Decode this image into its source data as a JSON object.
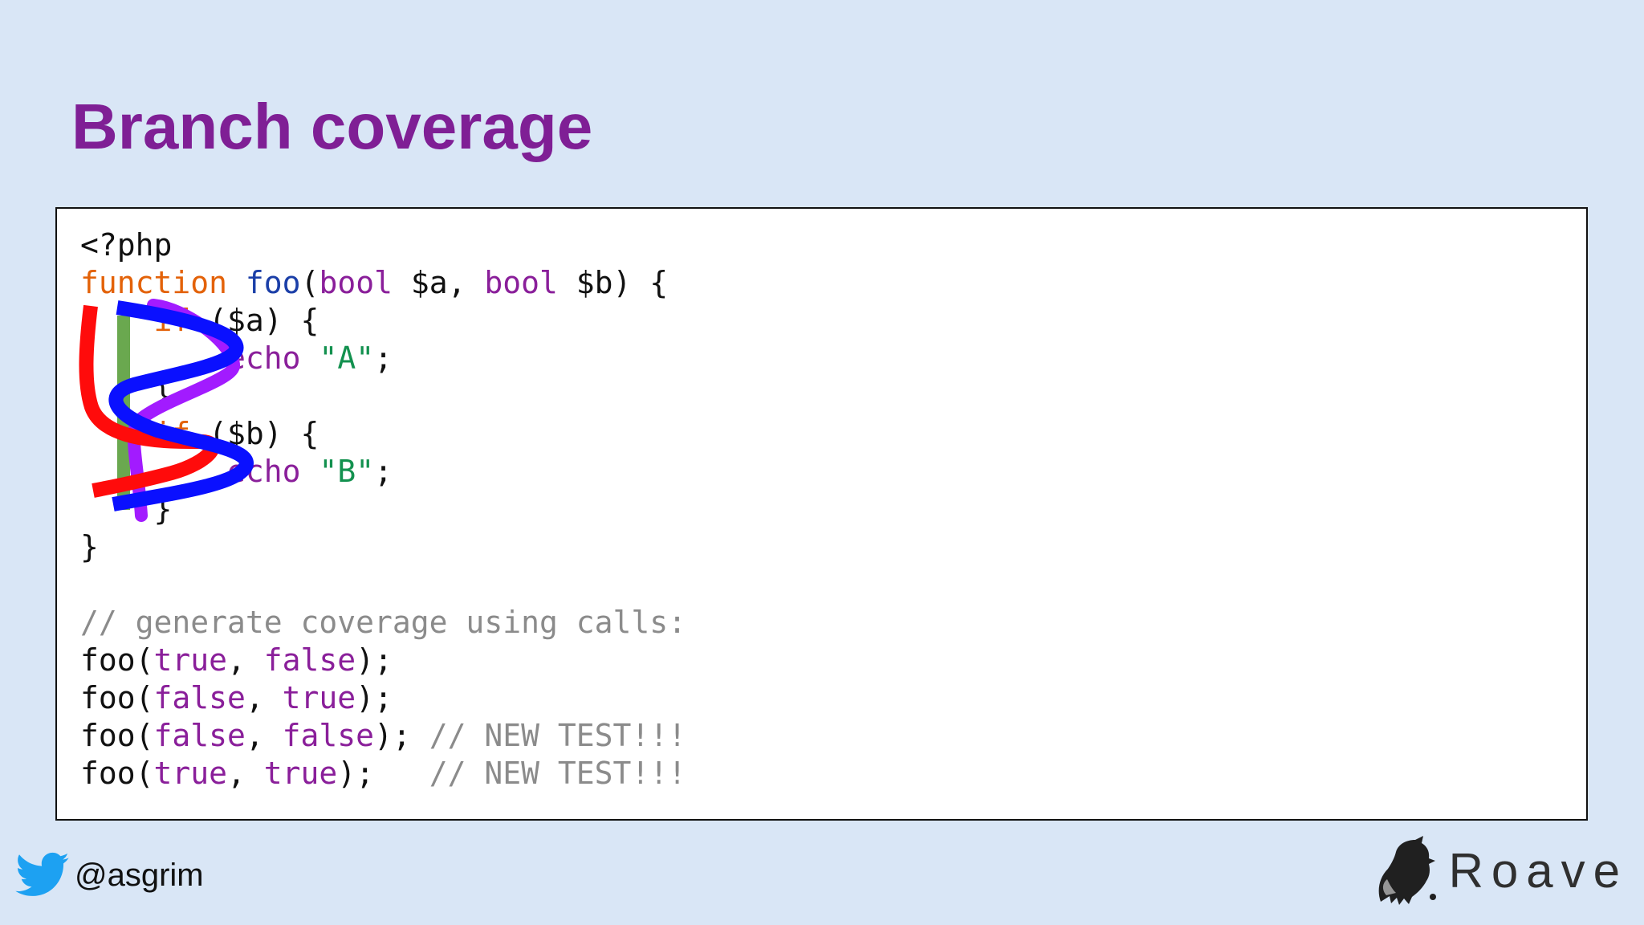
{
  "slide": {
    "title": "Branch coverage"
  },
  "code": {
    "lines": [
      [
        {
          "t": "<?php",
          "c": "plain"
        }
      ],
      [
        {
          "t": "function",
          "c": "kw"
        },
        {
          "t": " ",
          "c": "plain"
        },
        {
          "t": "foo",
          "c": "fn"
        },
        {
          "t": "(",
          "c": "plain"
        },
        {
          "t": "bool",
          "c": "type"
        },
        {
          "t": " $a, ",
          "c": "plain"
        },
        {
          "t": "bool",
          "c": "type"
        },
        {
          "t": " $b) {",
          "c": "plain"
        }
      ],
      [
        {
          "t": "    ",
          "c": "plain"
        },
        {
          "t": "if",
          "c": "kw"
        },
        {
          "t": " ($a) {",
          "c": "plain"
        }
      ],
      [
        {
          "t": "        ",
          "c": "plain"
        },
        {
          "t": "echo",
          "c": "type"
        },
        {
          "t": " ",
          "c": "plain"
        },
        {
          "t": "\"A\"",
          "c": "str"
        },
        {
          "t": ";",
          "c": "plain"
        }
      ],
      [
        {
          "t": "    }",
          "c": "plain"
        }
      ],
      [
        {
          "t": "    ",
          "c": "plain"
        },
        {
          "t": "if",
          "c": "kw"
        },
        {
          "t": " ($b) {",
          "c": "plain"
        }
      ],
      [
        {
          "t": "        ",
          "c": "plain"
        },
        {
          "t": "echo",
          "c": "type"
        },
        {
          "t": " ",
          "c": "plain"
        },
        {
          "t": "\"B\"",
          "c": "str"
        },
        {
          "t": ";",
          "c": "plain"
        }
      ],
      [
        {
          "t": "    }",
          "c": "plain"
        }
      ],
      [
        {
          "t": "}",
          "c": "plain"
        }
      ],
      [],
      [
        {
          "t": "// generate coverage using calls:",
          "c": "cmt"
        }
      ],
      [
        {
          "t": "foo(",
          "c": "plain"
        },
        {
          "t": "true",
          "c": "bool"
        },
        {
          "t": ", ",
          "c": "plain"
        },
        {
          "t": "false",
          "c": "bool"
        },
        {
          "t": ");",
          "c": "plain"
        }
      ],
      [
        {
          "t": "foo(",
          "c": "plain"
        },
        {
          "t": "false",
          "c": "bool"
        },
        {
          "t": ", ",
          "c": "plain"
        },
        {
          "t": "true",
          "c": "bool"
        },
        {
          "t": ");",
          "c": "plain"
        }
      ],
      [
        {
          "t": "foo(",
          "c": "plain"
        },
        {
          "t": "false",
          "c": "bool"
        },
        {
          "t": ", ",
          "c": "plain"
        },
        {
          "t": "false",
          "c": "bool"
        },
        {
          "t": "); ",
          "c": "plain"
        },
        {
          "t": "// NEW TEST!!!",
          "c": "cmt"
        }
      ],
      [
        {
          "t": "foo(",
          "c": "plain"
        },
        {
          "t": "true",
          "c": "bool"
        },
        {
          "t": ", ",
          "c": "plain"
        },
        {
          "t": "true",
          "c": "bool"
        },
        {
          "t": ");   ",
          "c": "plain"
        },
        {
          "t": "// NEW TEST!!!",
          "c": "cmt"
        }
      ]
    ]
  },
  "annotations": {
    "paths": [
      {
        "name": "red-path",
        "color": "#ff0b0b"
      },
      {
        "name": "green-path",
        "color": "#6aa84f"
      },
      {
        "name": "purple-path",
        "color": "#a21bff"
      },
      {
        "name": "blue-path",
        "color": "#0a10ff"
      }
    ]
  },
  "footer": {
    "handle": "@asgrim",
    "brand": "Roave",
    "icons": {
      "social": "twitter-bird-icon",
      "brand_mark": "roave-logo-icon"
    }
  },
  "colors": {
    "background": "#d9e6f6",
    "title": "#7f1f95",
    "panel": "#ffffff",
    "twitter": "#1da1f2"
  }
}
